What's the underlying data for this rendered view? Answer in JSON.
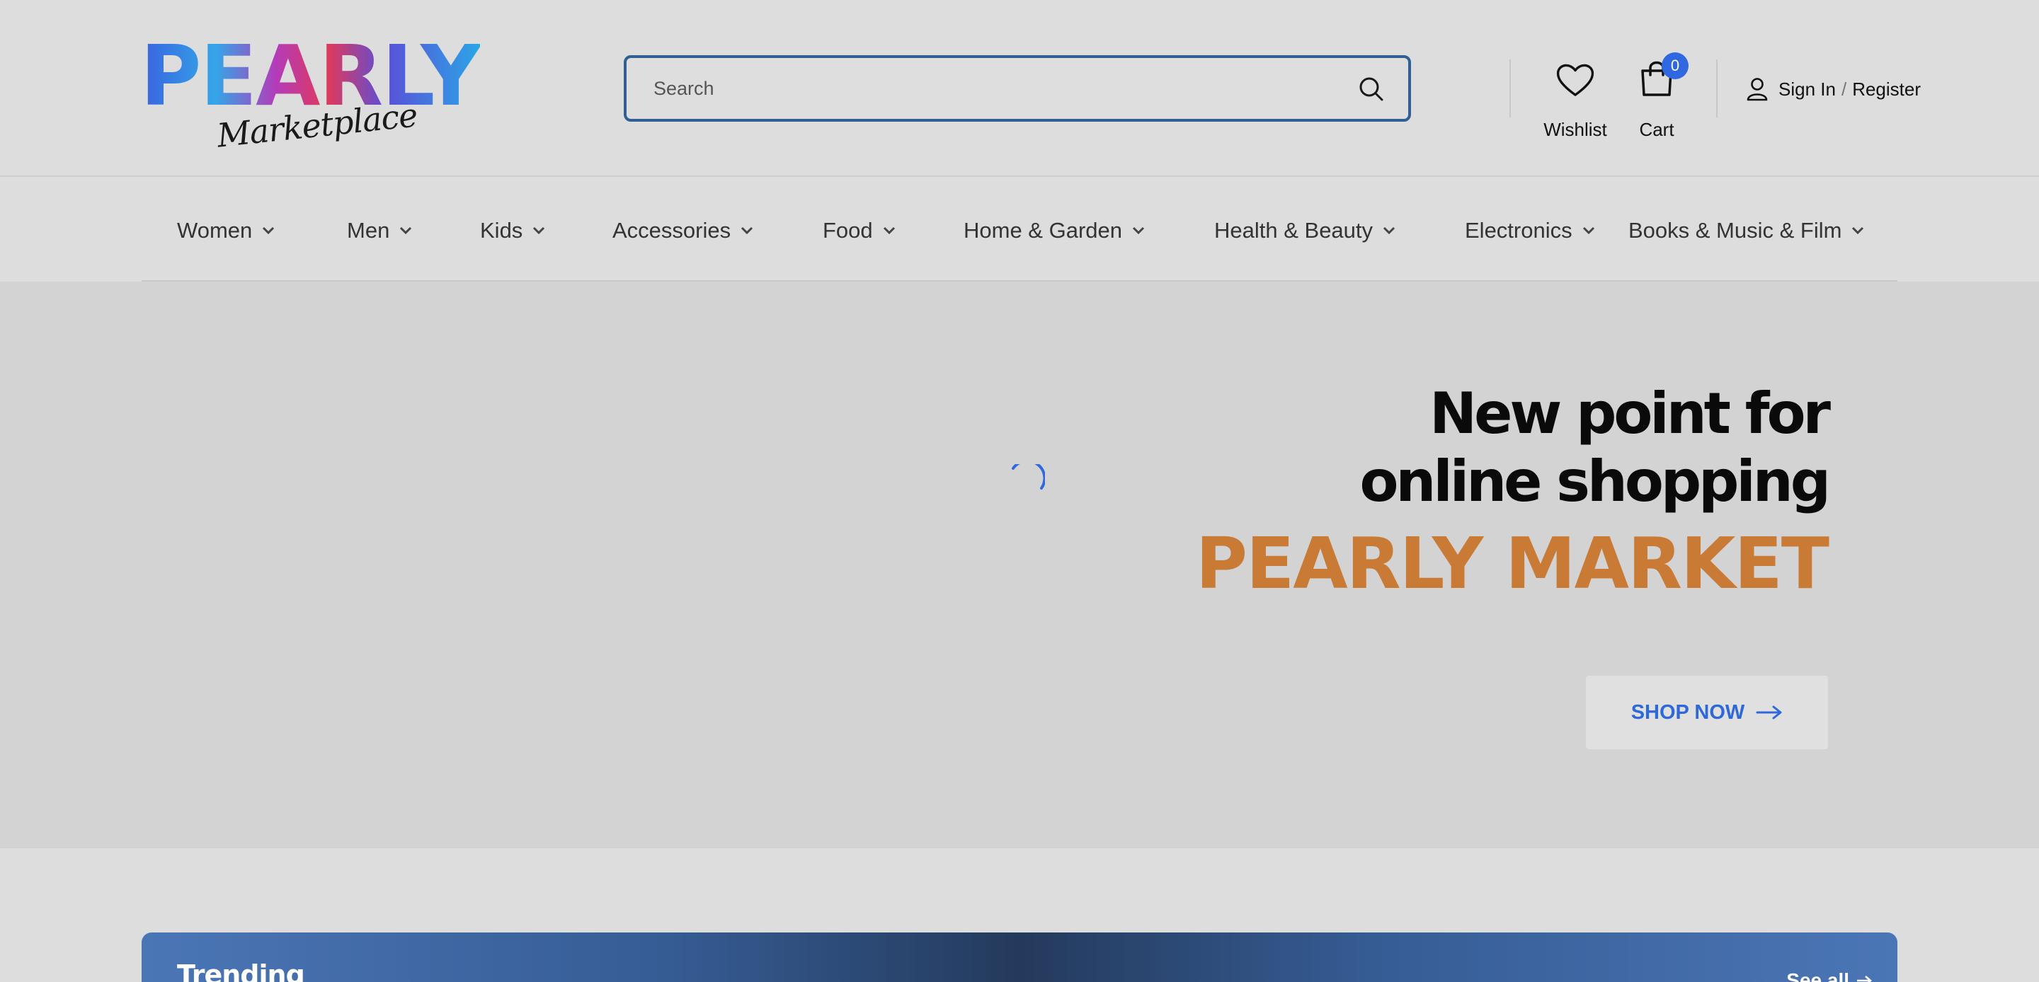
{
  "header": {
    "logo_main": "PEARLY",
    "logo_sub": "Marketplace",
    "search_placeholder": "Search",
    "wishlist_label": "Wishlist",
    "cart_label": "Cart",
    "cart_count": "0",
    "sign_in_label": "Sign In",
    "separator": "/",
    "register_label": "Register"
  },
  "nav": {
    "items": [
      {
        "label": "Women"
      },
      {
        "label": "Men"
      },
      {
        "label": "Kids"
      },
      {
        "label": "Accessories"
      },
      {
        "label": "Food"
      },
      {
        "label": "Home & Garden"
      },
      {
        "label": "Health & Beauty"
      },
      {
        "label": "Electronics"
      },
      {
        "label": "Books & Music & Film"
      }
    ]
  },
  "hero": {
    "line1": "New point for",
    "line2": "online shopping",
    "brand": "PEARLY MARKET",
    "cta_label": "SHOP NOW"
  },
  "trending": {
    "title": "Trending",
    "see_all_label": "See all"
  },
  "colors": {
    "accent_blue": "#2f68e0",
    "brand_orange": "#c97a35",
    "search_border": "#2f5f95"
  },
  "icons": {
    "search": "search-icon",
    "wishlist": "heart-icon",
    "cart": "shopping-bag-icon",
    "account": "user-icon",
    "dropdown": "chevron-down-icon",
    "cta": "arrow-right-icon",
    "loading": "spinner-icon"
  }
}
